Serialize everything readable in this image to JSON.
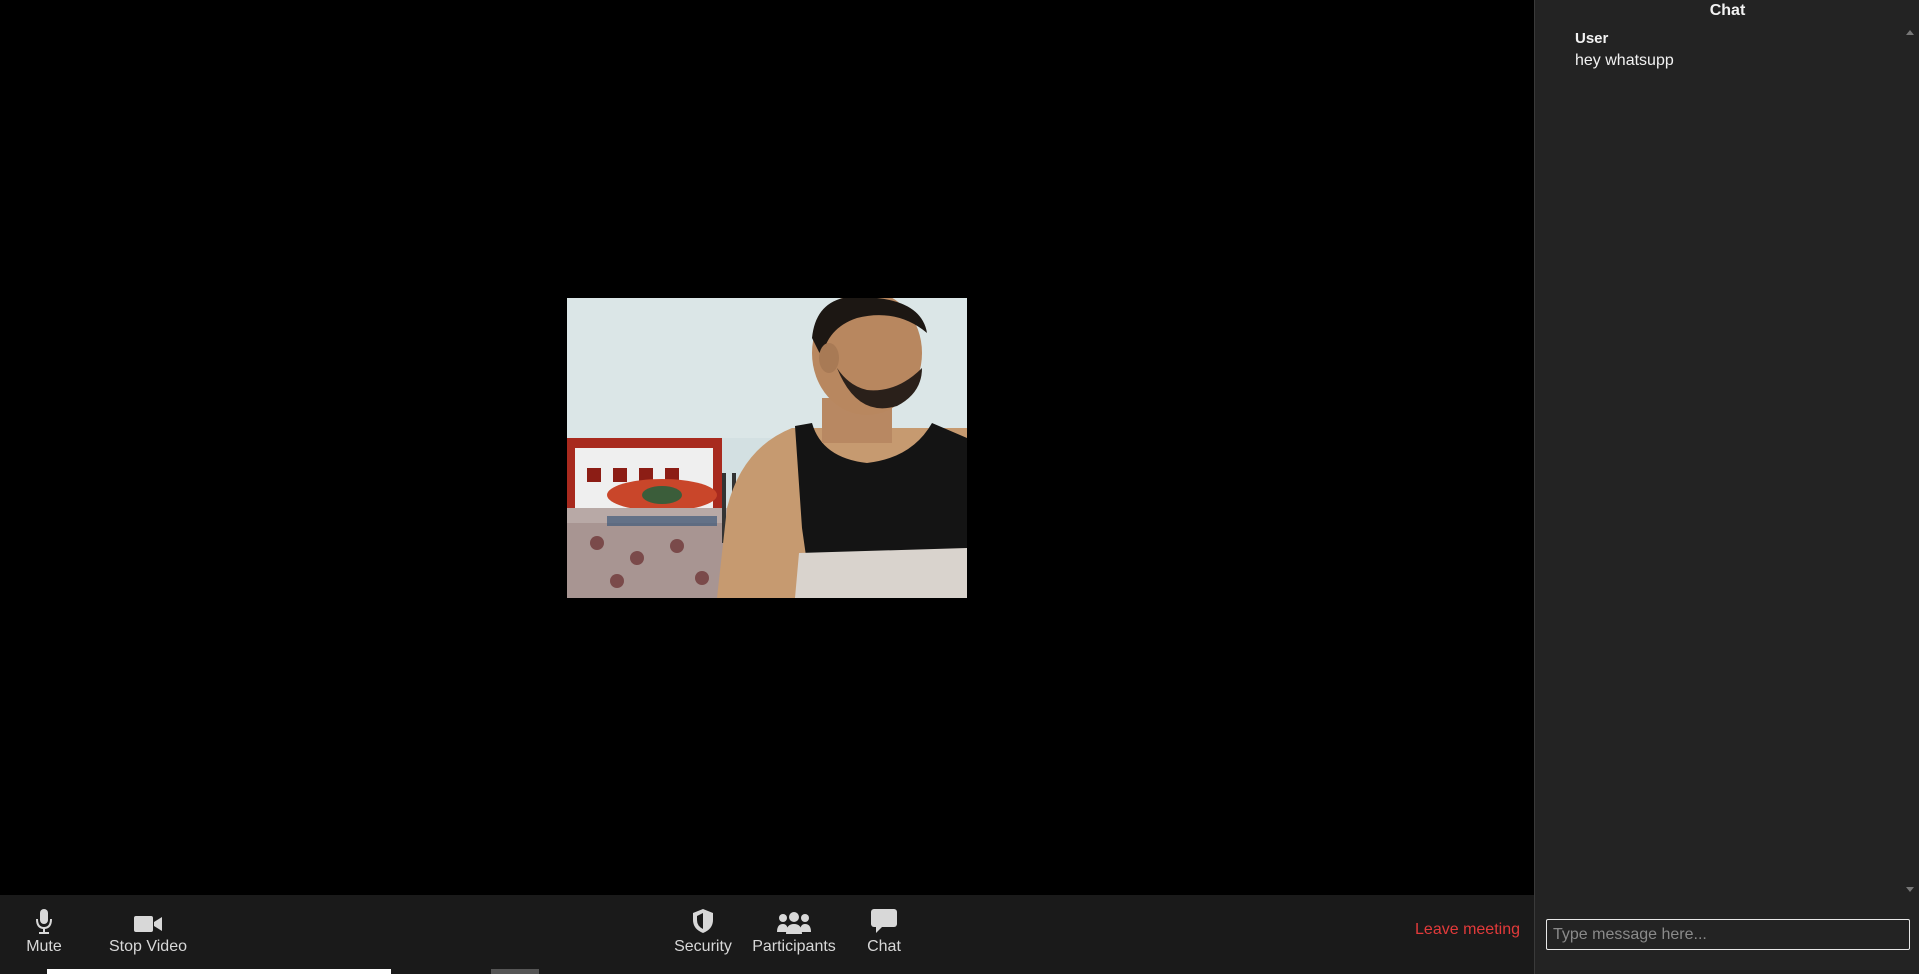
{
  "toolbar": {
    "mute_label": "Mute",
    "stop_video_label": "Stop Video",
    "security_label": "Security",
    "participants_label": "Participants",
    "chat_label": "Chat",
    "leave_label": "Leave meeting"
  },
  "icons": {
    "mute": "microphone-icon",
    "stop_video": "video-camera-icon",
    "security": "shield-icon",
    "participants": "people-icon",
    "chat": "speech-bubble-icon"
  },
  "chat": {
    "title": "Chat",
    "messages": [
      {
        "sender": "User",
        "text": "hey whatsupp"
      }
    ],
    "input_placeholder": "Type message here..."
  },
  "colors": {
    "leave": "#e23a3a",
    "toolbar_bg": "#1a1a1a",
    "chat_bg": "#232323"
  }
}
